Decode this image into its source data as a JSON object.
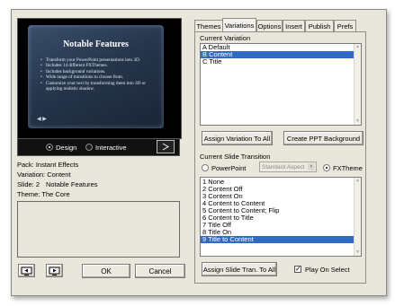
{
  "preview": {
    "slide_title": "Notable Features",
    "bullets": [
      "Transform your PowerPoint presentations into 3D.",
      "Includes 14 different FXThemes.",
      "Includes background variations.",
      "Wide range of transitions to choose from.",
      "Customize your text by transforming them into 3D or applying realistic shadow."
    ],
    "nav_arrows": "◀ ▶"
  },
  "mode": {
    "design_label": "Design",
    "interactive_label": "Interactive",
    "selected": "Design",
    "play_icon": "play-icon"
  },
  "info": {
    "pack": "Pack: Instant Effects",
    "variation": "Variation: Content",
    "slide": "Slide: 2",
    "slide_name": "Notable Features",
    "theme": "Theme: The Core"
  },
  "footer": {
    "ok_label": "OK",
    "cancel_label": "Cancel"
  },
  "tabs": [
    {
      "label": "Themes",
      "active": false
    },
    {
      "label": "Variations",
      "active": true
    },
    {
      "label": "Options",
      "active": false
    },
    {
      "label": "Insert",
      "active": false
    },
    {
      "label": "Publish",
      "active": false
    },
    {
      "label": "Prefs",
      "active": false
    }
  ],
  "current_variation": {
    "heading": "Current Variation",
    "items": [
      "A  Default",
      "B  Content",
      "C  Title"
    ],
    "selected_index": 1,
    "assign_label": "Assign Variation To All",
    "create_bg_label": "Create PPT Background"
  },
  "slide_transition": {
    "heading": "Current Slide Transition",
    "powerpoint_label": "PowerPoint",
    "aspect_value": "Standard Aspect",
    "fxtheme_label": "FXTheme",
    "selected_mode": "FXTheme",
    "items": [
      "1  None",
      "2  Content Off",
      "3  Content On",
      "4  Content to Content",
      "5  Content to Content; Flip",
      "6  Content to Title",
      "7  Title Off",
      "8  Title On",
      "9  Title to Content"
    ],
    "selected_index": 8,
    "assign_label": "Assign Slide Tran. To All",
    "play_on_select_label": "Play On Select",
    "play_on_select_checked": true,
    "check_mark": "✓"
  },
  "colors": {
    "selection": "#316ac5",
    "dialog_bg": "#e9e6dc"
  }
}
